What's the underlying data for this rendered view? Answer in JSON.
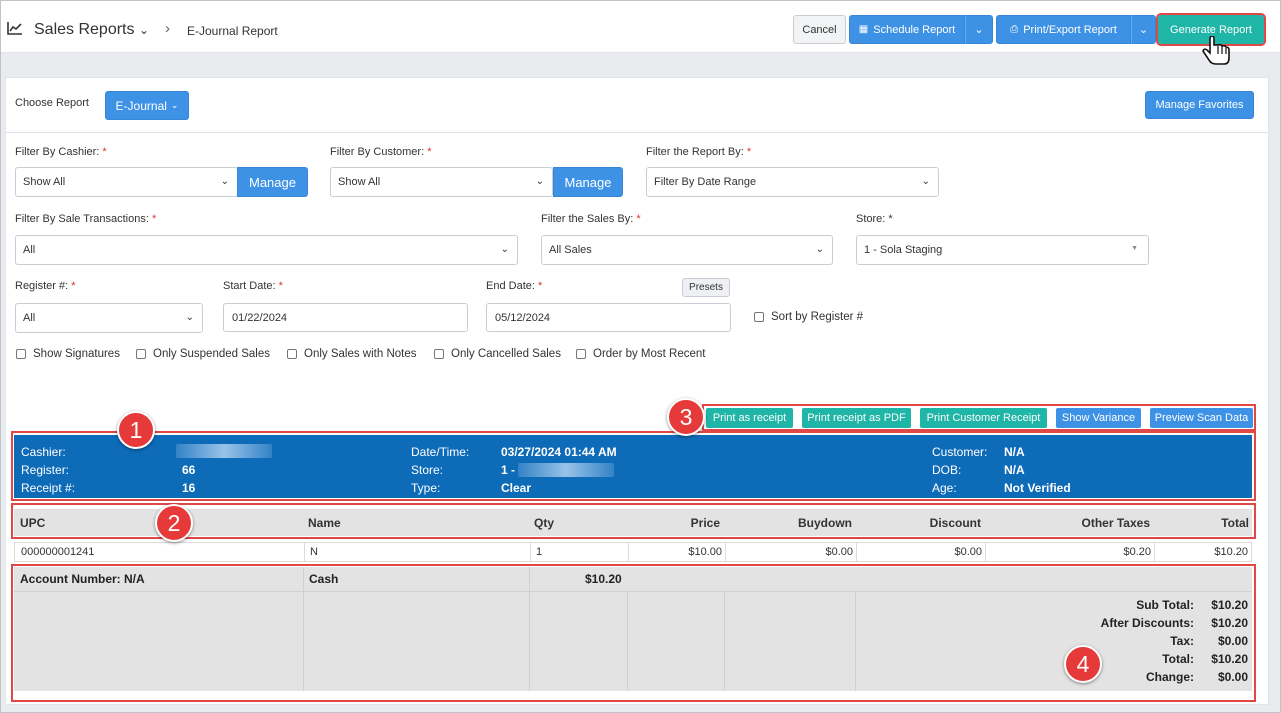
{
  "header": {
    "title": "Sales Reports",
    "breadcrumb": "E-Journal Report",
    "cancel_label": "Cancel",
    "schedule_label": "Schedule Report",
    "print_export_label": "Print/Export Report",
    "generate_label": "Generate Report"
  },
  "choose": {
    "label": "Choose Report",
    "report_value": "E-Journal",
    "favorites_label": "Manage Favorites"
  },
  "filters": {
    "cashier_label": "Filter By Cashier:",
    "cashier_value": "Show All",
    "customer_label": "Filter By Customer:",
    "customer_value": "Show All",
    "manage_label": "Manage",
    "report_by_label": "Filter the Report By:",
    "report_by_value": "Filter By Date Range",
    "sale_tx_label": "Filter By Sale Transactions:",
    "sale_tx_value": "All",
    "sales_by_label": "Filter the Sales By:",
    "sales_by_value": "All Sales",
    "store_label": "Store:",
    "store_value": "1 - Sola Staging",
    "register_label": "Register #:",
    "register_value": "All",
    "start_label": "Start Date:",
    "start_value": "01/22/2024",
    "end_label": "End Date:",
    "end_value": "05/12/2024",
    "presets_label": "Presets",
    "sort_register_label": "Sort by Register #",
    "req_mark": "*"
  },
  "checkboxes": [
    "Show Signatures",
    "Only Suspended Sales",
    "Only Sales with Notes",
    "Only Cancelled Sales",
    "Order by Most Recent"
  ],
  "actions": {
    "print_receipt": "Print as receipt",
    "print_pdf": "Print receipt as PDF",
    "print_customer": "Print Customer Receipt",
    "show_variance": "Show Variance",
    "preview_scan": "Preview Scan Data"
  },
  "markers": [
    "1",
    "2",
    "3",
    "4"
  ],
  "receipt": {
    "cashier_label": "Cashier:",
    "register_label": "Register:",
    "register_value": "66",
    "receipt_label": "Receipt #:",
    "receipt_value": "16",
    "datetime_label": "Date/Time:",
    "datetime_value": "03/27/2024 01:44 AM",
    "store_label": "Store:",
    "store_value": "1 -",
    "type_label": "Type:",
    "type_value": "Clear",
    "customer_label": "Customer:",
    "customer_value": "N/A",
    "dob_label": "DOB:",
    "dob_value": "N/A",
    "age_label": "Age:",
    "age_value": "Not Verified"
  },
  "table": {
    "columns": [
      "UPC",
      "Name",
      "Qty",
      "Price",
      "Buydown",
      "Discount",
      "Other Taxes",
      "Total"
    ],
    "rows": [
      [
        "000000001241",
        "N",
        "1",
        "$10.00",
        "$0.00",
        "$0.00",
        "$0.20",
        "$10.20"
      ]
    ]
  },
  "footer": {
    "account": "Account Number: N/A",
    "tender": "Cash",
    "tender_amount": "$10.20",
    "totals": [
      {
        "label": "Sub Total:",
        "value": "$10.20"
      },
      {
        "label": "After Discounts:",
        "value": "$10.20"
      },
      {
        "label": "Tax:",
        "value": "$0.00"
      },
      {
        "label": "Total:",
        "value": "$10.20"
      },
      {
        "label": "Change:",
        "value": "$0.00"
      }
    ]
  },
  "colors": {
    "primary_blue": "#3e92e6",
    "teal": "#1fb5a7",
    "receipt_header": "#0e6bb8",
    "annotation_red": "#e04848"
  }
}
